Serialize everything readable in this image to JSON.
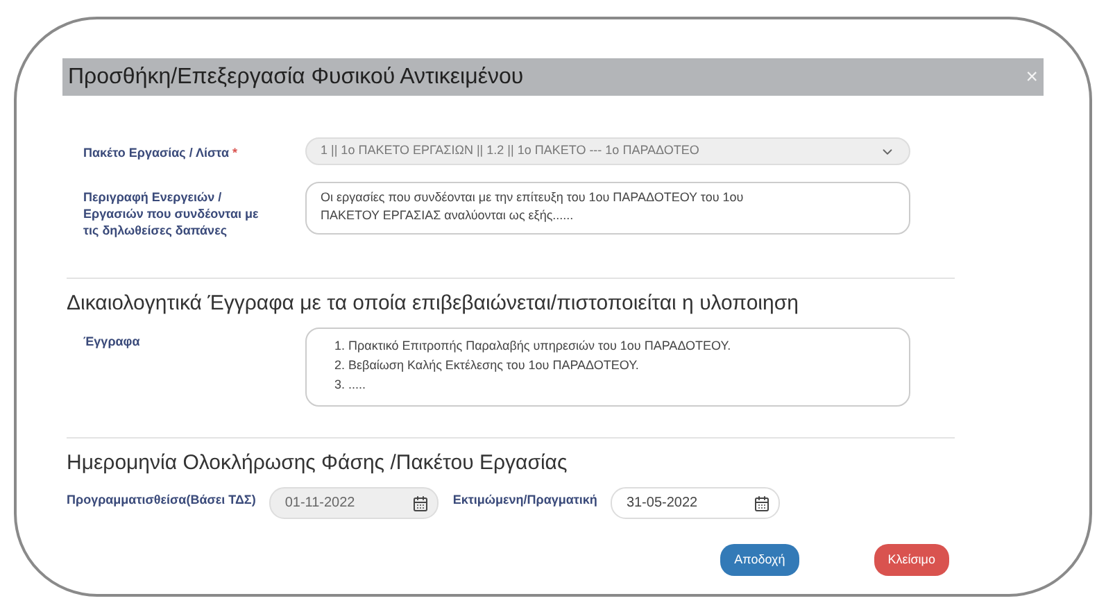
{
  "dialog": {
    "title": "Προσθήκη/Επεξεργασία Φυσικού Αντικειμένου",
    "close": "×"
  },
  "fields": [
    {
      "label": "Πακέτο Εργασίας / Λίστα",
      "required_mark": "*",
      "kind": "select",
      "value": "1 || 1ο ΠΑΚΕΤΟ ΕΡΓΑΣΙΩΝ || 1.2 || 1ο ΠΑΚΕΤΟ --- 1ο ΠΑΡΑΔΟΤΕΟ",
      "disabled": true
    },
    {
      "label": "Περιγραφή Ενεργειών / Εργασιών που συνδέονται με τις δηλωθείσες δαπάνες",
      "kind": "textarea",
      "lines": [
        "Οι εργασίες που συνδέονται με την επίτευξη του 1ου ΠΑΡΑΔΟΤΕΟΥ του 1ου",
        "ΠΑΚΕΤΟΥ ΕΡΓΑΣΙΑΣ αναλύονται ως εξής......"
      ],
      "disabled": false
    }
  ],
  "documents_section": {
    "heading": "Δικαιολογητικά Έγγραφα με τα οποία επιβεβαιώνεται/πιστοποιείται η υλοποιηση",
    "label": "Έγγραφα",
    "lines": [
      "1. Πρακτικό Επιτροπής Παραλαβής υπηρεσιών του 1ου ΠΑΡΑΔΟΤΕΟΥ.",
      "2. Βεβαίωση Καλής Εκτέλεσης του 1ου ΠΑΡΑΔΟΤΕΟΥ.",
      "3. ....."
    ]
  },
  "dates_section": {
    "heading": "Ημερομηνία Ολοκλήρωσης Φάσης /Πακέτου Εργασίας",
    "dates": [
      {
        "label": "Προγραμματισθείσα(Βάσει ΤΔΣ)",
        "value": "01-11-2022",
        "disabled": true
      },
      {
        "label": "Εκτιμώμενη/Πραγματική",
        "value": "31-05-2022",
        "disabled": false
      }
    ]
  },
  "buttons": [
    {
      "label": "Αποδοχή",
      "kind": "primary"
    },
    {
      "label": "Κλείσιμο",
      "kind": "danger"
    }
  ]
}
